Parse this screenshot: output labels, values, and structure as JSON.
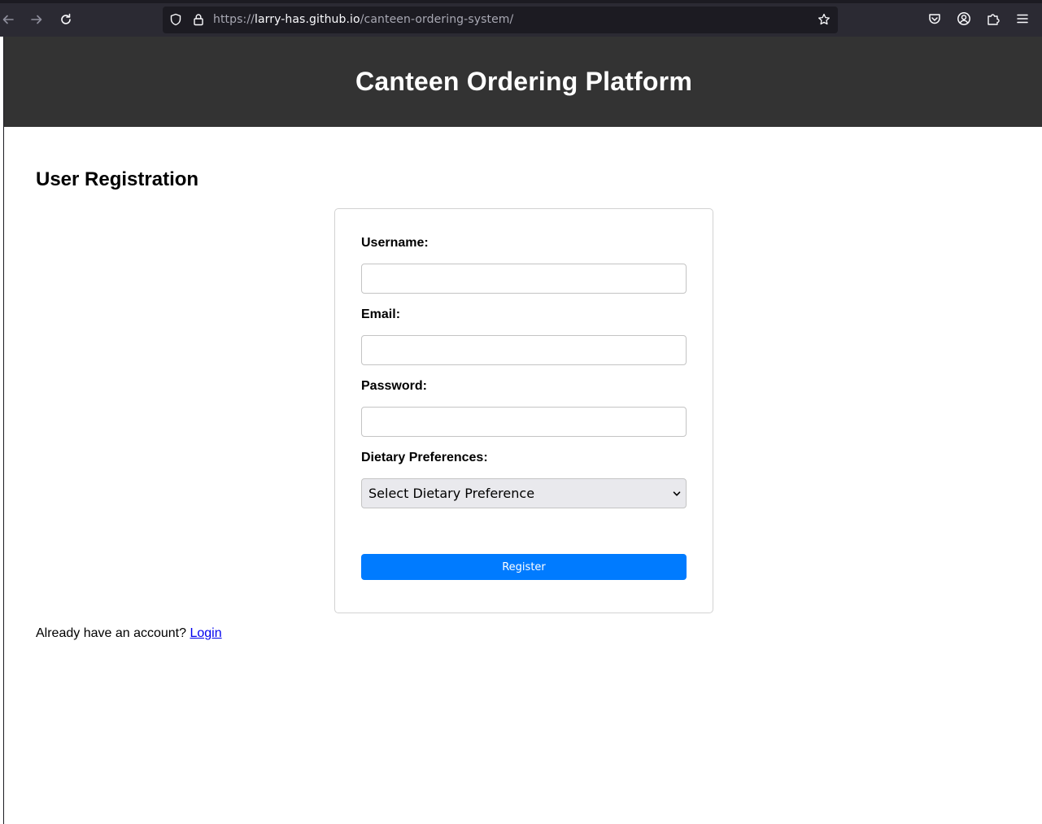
{
  "browser": {
    "url_prefix": "https://",
    "url_domain": "larry-has.github.io",
    "url_path": "/canteen-ordering-system/",
    "icons": [
      "back-arrow-icon",
      "forward-arrow-icon",
      "reload-icon",
      "shield-icon",
      "lock-icon",
      "star-icon",
      "pocket-icon",
      "account-icon",
      "extensions-icon",
      "menu-icon"
    ]
  },
  "header": {
    "title": "Canteen Ordering Platform",
    "background": "#333333"
  },
  "registration": {
    "title": "User Registration",
    "username_label": "Username:",
    "username_value": "",
    "email_label": "Email:",
    "email_value": "",
    "password_label": "Password:",
    "password_value": "",
    "dietary_label": "Dietary Preferences:",
    "dietary_selected": "Select Dietary Preference",
    "register_label": "Register",
    "register_color": "#007bff"
  },
  "footer": {
    "prompt": "Already have an account? ",
    "login_link": "Login"
  }
}
